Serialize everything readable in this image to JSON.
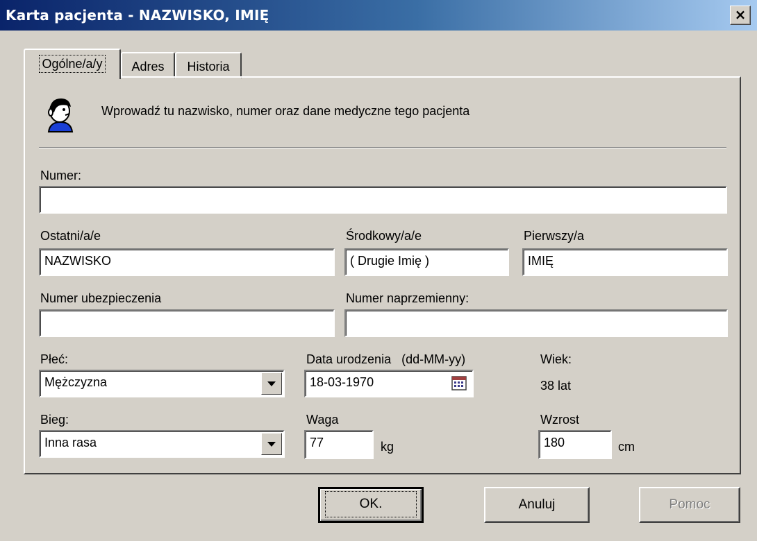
{
  "window": {
    "title": "Karta pacjenta - NAZWISKO, IMIĘ",
    "close_label": "×"
  },
  "tabs": [
    {
      "label": "Ogólne/a/y",
      "active": true
    },
    {
      "label": "Adres",
      "active": false
    },
    {
      "label": "Historia",
      "active": false
    }
  ],
  "header": {
    "description": "Wprowadź tu nazwisko, numer oraz dane medyczne tego pacjenta",
    "icon": "patient-head-icon"
  },
  "fields": {
    "numer": {
      "label": "Numer:",
      "value": ""
    },
    "ostatni": {
      "label": "Ostatni/a/e",
      "value": "NAZWISKO"
    },
    "srodkowy": {
      "label": "Środkowy/a/e",
      "value": "( Drugie Imię )"
    },
    "pierwszy": {
      "label": "Pierwszy/a",
      "value": "IMIĘ"
    },
    "ubezpieczenie": {
      "label": "Numer ubezpieczenia",
      "value": ""
    },
    "naprzemienny": {
      "label": "Numer naprzemienny:",
      "value": ""
    },
    "plec": {
      "label": "Płeć:",
      "value": "Mężczyzna"
    },
    "data_urodzenia": {
      "label": "Data urodzenia",
      "format": "(dd-MM-yy)",
      "value": "18-03-1970"
    },
    "wiek": {
      "label": "Wiek:",
      "value": "38 lat"
    },
    "bieg": {
      "label": "Bieg:",
      "value": "Inna rasa"
    },
    "waga": {
      "label": "Waga",
      "value": "77",
      "unit": "kg"
    },
    "wzrost": {
      "label": "Wzrost",
      "value": "180",
      "unit": "cm"
    }
  },
  "buttons": {
    "ok": "OK.",
    "cancel": "Anuluj",
    "help": "Pomoc"
  }
}
